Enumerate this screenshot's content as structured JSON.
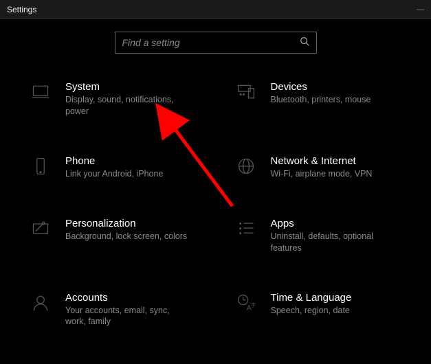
{
  "window": {
    "title": "Settings"
  },
  "search": {
    "placeholder": "Find a setting"
  },
  "tiles": {
    "system": {
      "title": "System",
      "desc": "Display, sound, notifications, power"
    },
    "devices": {
      "title": "Devices",
      "desc": "Bluetooth, printers, mouse"
    },
    "phone": {
      "title": "Phone",
      "desc": "Link your Android, iPhone"
    },
    "network": {
      "title": "Network & Internet",
      "desc": "Wi-Fi, airplane mode, VPN"
    },
    "personalization": {
      "title": "Personalization",
      "desc": "Background, lock screen, colors"
    },
    "apps": {
      "title": "Apps",
      "desc": "Uninstall, defaults, optional features"
    },
    "accounts": {
      "title": "Accounts",
      "desc": "Your accounts, email, sync, work, family"
    },
    "timeLanguage": {
      "title": "Time & Language",
      "desc": "Speech, region, date"
    }
  },
  "annotation": {
    "arrow_color": "#ff0000"
  }
}
